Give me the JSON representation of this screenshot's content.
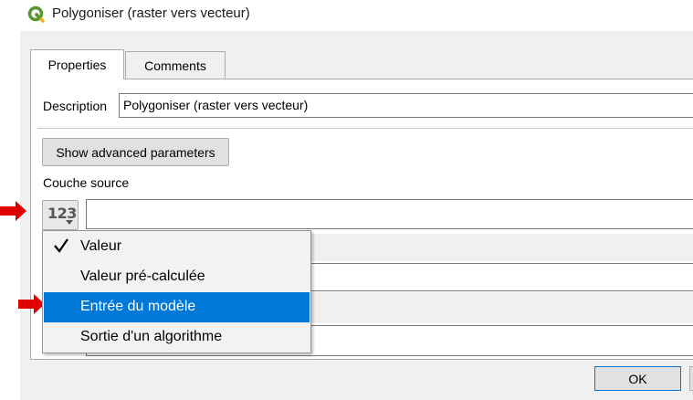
{
  "window": {
    "title": "Polygoniser (raster vers vecteur)"
  },
  "tabs": [
    {
      "label": "Properties"
    },
    {
      "label": "Comments"
    }
  ],
  "description": {
    "label": "Description",
    "value": "Polygoniser (raster vers vecteur)"
  },
  "advanced_button": {
    "label": "Show advanced parameters"
  },
  "source": {
    "label": "Couche source",
    "value_type_icon": "123",
    "value": ""
  },
  "menu": {
    "items": [
      {
        "label": "Valeur",
        "checked": true
      },
      {
        "label": "Valeur pré-calculée"
      },
      {
        "label": "Entrée du modèle",
        "highlighted": true
      },
      {
        "label": "Sortie d'un algorithme"
      }
    ]
  },
  "footer": {
    "ok_label": "OK"
  },
  "colors": {
    "highlight": "#0078d7",
    "arrow": "#e00000",
    "qgis_green": "#589632"
  }
}
